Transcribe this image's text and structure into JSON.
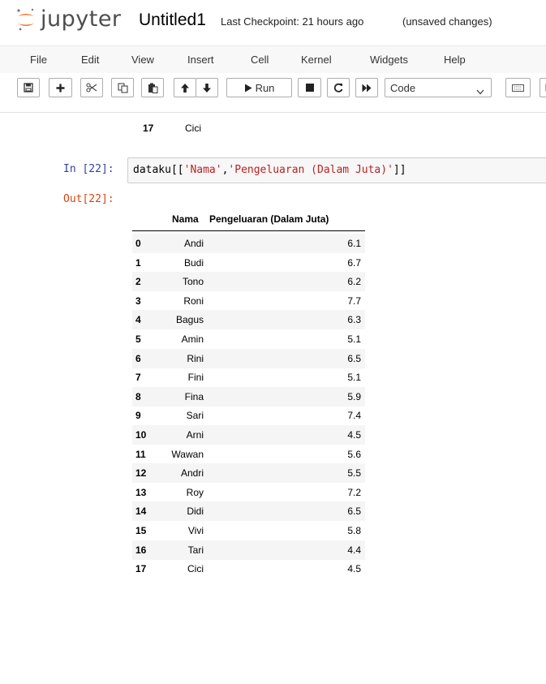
{
  "header": {
    "logo_text": "jupyter",
    "notebook_title": "Untitled1",
    "checkpoint": "Last Checkpoint: 21 hours ago",
    "autosave_status": "(unsaved changes)"
  },
  "menubar": {
    "items": [
      "File",
      "Edit",
      "View",
      "Insert",
      "Cell",
      "Kernel",
      "Widgets",
      "Help"
    ]
  },
  "toolbar": {
    "run_label": "Run",
    "cell_type": "Code",
    "icons": [
      "save-icon",
      "plus-icon",
      "cut-icon",
      "copy-icon",
      "paste-icon",
      "arrow-up-icon",
      "arrow-down-icon",
      "run-icon",
      "stop-icon",
      "restart-icon",
      "fast-forward-icon",
      "keyboard-icon"
    ]
  },
  "previous_output": {
    "last_row": {
      "idx": "17",
      "nama": "Cici"
    }
  },
  "cell": {
    "in_prompt": "In [22]:",
    "code_prefix": "dataku[[",
    "code_str1": "'Nama'",
    "code_comma": ",",
    "code_str2": "'Pengeluaran (Dalam Juta)'",
    "code_suffix": "]]",
    "out_prompt": "Out[22]:",
    "table": {
      "columns": [
        "Nama",
        "Pengeluaran (Dalam Juta)"
      ],
      "rows": [
        {
          "idx": "0",
          "nama": "Andi",
          "val": "6.1"
        },
        {
          "idx": "1",
          "nama": "Budi",
          "val": "6.7"
        },
        {
          "idx": "2",
          "nama": "Tono",
          "val": "6.2"
        },
        {
          "idx": "3",
          "nama": "Roni",
          "val": "7.7"
        },
        {
          "idx": "4",
          "nama": "Bagus",
          "val": "6.3"
        },
        {
          "idx": "5",
          "nama": "Amin",
          "val": "5.1"
        },
        {
          "idx": "6",
          "nama": "Rini",
          "val": "6.5"
        },
        {
          "idx": "7",
          "nama": "Fini",
          "val": "5.1"
        },
        {
          "idx": "8",
          "nama": "Fina",
          "val": "5.9"
        },
        {
          "idx": "9",
          "nama": "Sari",
          "val": "7.4"
        },
        {
          "idx": "10",
          "nama": "Arni",
          "val": "4.5"
        },
        {
          "idx": "11",
          "nama": "Wawan",
          "val": "5.6"
        },
        {
          "idx": "12",
          "nama": "Andri",
          "val": "5.5"
        },
        {
          "idx": "13",
          "nama": "Roy",
          "val": "7.2"
        },
        {
          "idx": "14",
          "nama": "Didi",
          "val": "6.5"
        },
        {
          "idx": "15",
          "nama": "Vivi",
          "val": "5.8"
        },
        {
          "idx": "16",
          "nama": "Tari",
          "val": "4.4"
        },
        {
          "idx": "17",
          "nama": "Cici",
          "val": "4.5"
        }
      ]
    }
  }
}
